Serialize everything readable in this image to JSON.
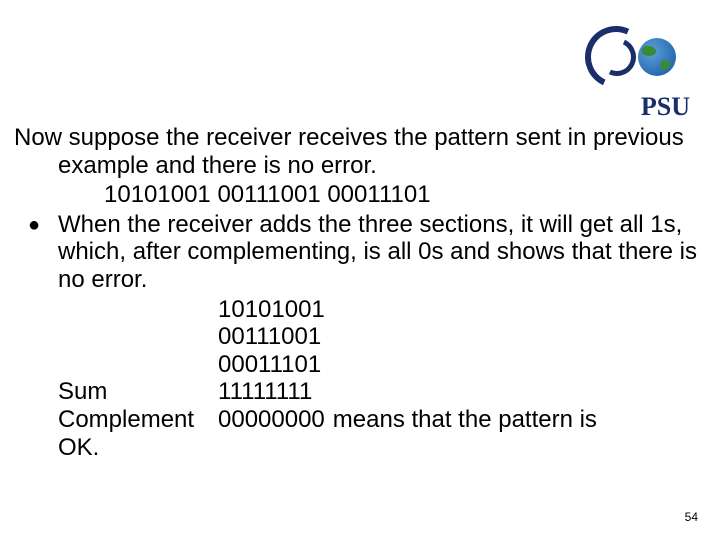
{
  "header": {
    "org_label": "PSU"
  },
  "content": {
    "para1": "Now suppose the receiver receives the pattern sent in previous example and there is no error.",
    "pattern_line": "10101001   00111001   00011101",
    "bullet_text": "When the receiver adds the three sections, it will get all 1s, which, after complementing, is all 0s and shows that there is no error.",
    "calc": {
      "r1": "10101001",
      "r2": "00111001",
      "r3": "00011101",
      "sum_label": "Sum",
      "sum_val": "11111111",
      "comp_label": "Complement",
      "comp_val": "00000000",
      "comp_rest": "means that the pattern is",
      "ok_label": "OK."
    }
  },
  "footer": {
    "page_number": "54"
  }
}
